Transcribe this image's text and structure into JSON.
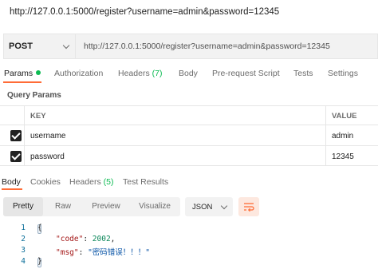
{
  "title_url": "http://127.0.0.1:5000/register?username=admin&password=12345",
  "request": {
    "method": "POST",
    "url": "http://127.0.0.1:5000/register?username=admin&password=12345"
  },
  "request_tabs": {
    "params": "Params",
    "authorization": "Authorization",
    "headers_label": "Headers",
    "headers_count": "(7)",
    "body": "Body",
    "prerequest": "Pre-request Script",
    "tests": "Tests",
    "settings": "Settings"
  },
  "query_params": {
    "title": "Query Params",
    "headers": {
      "key": "KEY",
      "value": "VALUE"
    },
    "rows": [
      {
        "key": "username",
        "value": "admin",
        "checked": true
      },
      {
        "key": "password",
        "value": "12345",
        "checked": true
      }
    ]
  },
  "response_tabs": {
    "body": "Body",
    "cookies": "Cookies",
    "headers_label": "Headers",
    "headers_count": "(5)",
    "test_results": "Test Results"
  },
  "view_modes": {
    "pretty": "Pretty",
    "raw": "Raw",
    "preview": "Preview",
    "visualize": "Visualize",
    "active": "Pretty"
  },
  "format": "JSON",
  "code": {
    "line_numbers": [
      "1",
      "2",
      "3",
      "4"
    ],
    "key1": "\"code\"",
    "val1": "2002",
    "key2": "\"msg\"",
    "val2": "\"密码错误！！！\""
  },
  "colors": {
    "accent": "#ff6c37",
    "params_dot": "#0cbb52",
    "json_key": "#a31515",
    "json_number": "#098658",
    "json_string": "#0451a5"
  },
  "icons": [
    "chevron-down-icon",
    "checkbox-checked-icon",
    "wrap-lines-icon",
    "fold-marker-icon"
  ]
}
